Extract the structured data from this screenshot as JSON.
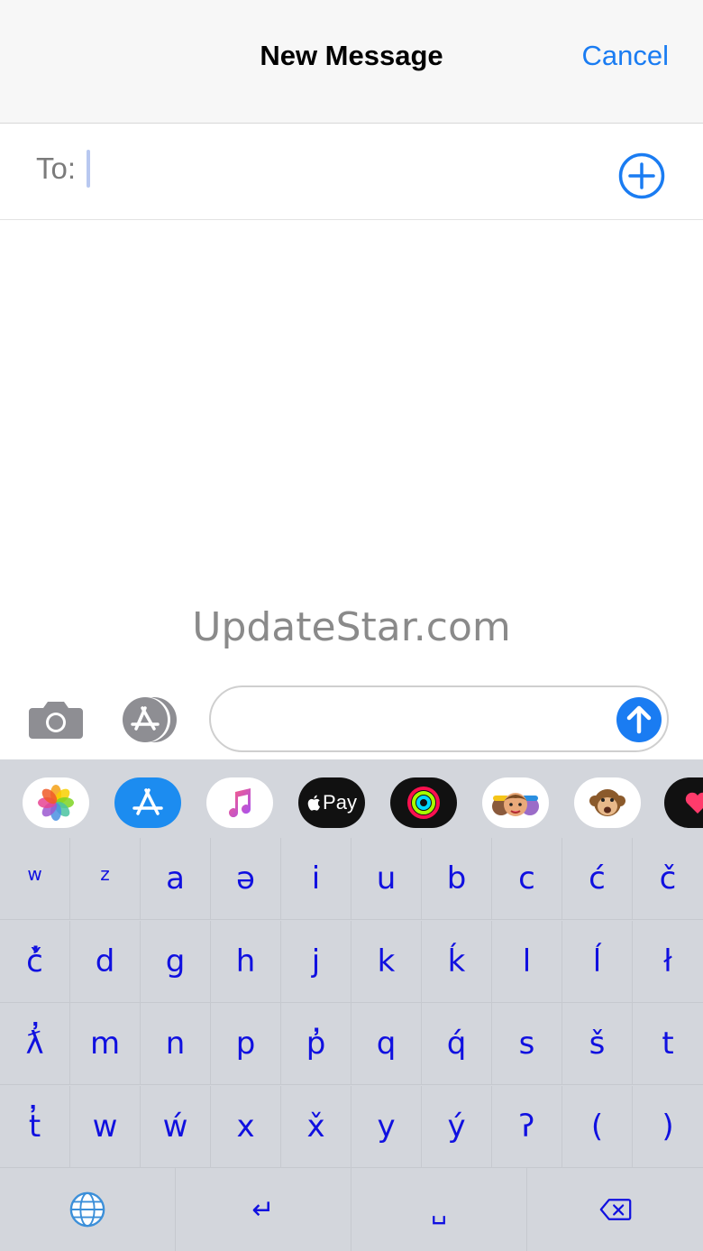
{
  "header": {
    "title": "New Message",
    "cancel_label": "Cancel"
  },
  "recipient": {
    "label": "To:",
    "value": ""
  },
  "watermark": "UpdateStar.com",
  "composer": {
    "placeholder": "",
    "value": ""
  },
  "colors": {
    "accent": "#1a7cf2",
    "key_text": "#1010e0",
    "keyboard_bg": "#d3d6dc"
  },
  "app_drawer": [
    "photos-icon",
    "app-store-icon",
    "music-icon",
    "apple-pay-icon",
    "activity-icon",
    "memoji-icon",
    "animoji-monkey-icon",
    "digital-touch-icon"
  ],
  "apple_pay_label": "Pay",
  "keyboard": {
    "rows": [
      [
        "w",
        "z",
        "a",
        "ə",
        "i",
        "u",
        "b",
        "c",
        "ć",
        "č"
      ],
      [
        "č̓",
        "d",
        "g",
        "h",
        "j",
        "k",
        "ḱ",
        "l",
        "ĺ",
        "ł"
      ],
      [
        "ƛ̓",
        "m",
        "n",
        "p",
        "p̓",
        "q",
        "q́",
        "s",
        "š",
        "t"
      ],
      [
        "t̓",
        "w",
        "ẃ",
        "x",
        "x̌",
        "y",
        "ý",
        "ʔ",
        "(",
        ")"
      ]
    ],
    "bottom": {
      "globe": "globe-icon",
      "return_label": "↵",
      "space_label": "␣",
      "delete": "backspace-icon"
    }
  }
}
